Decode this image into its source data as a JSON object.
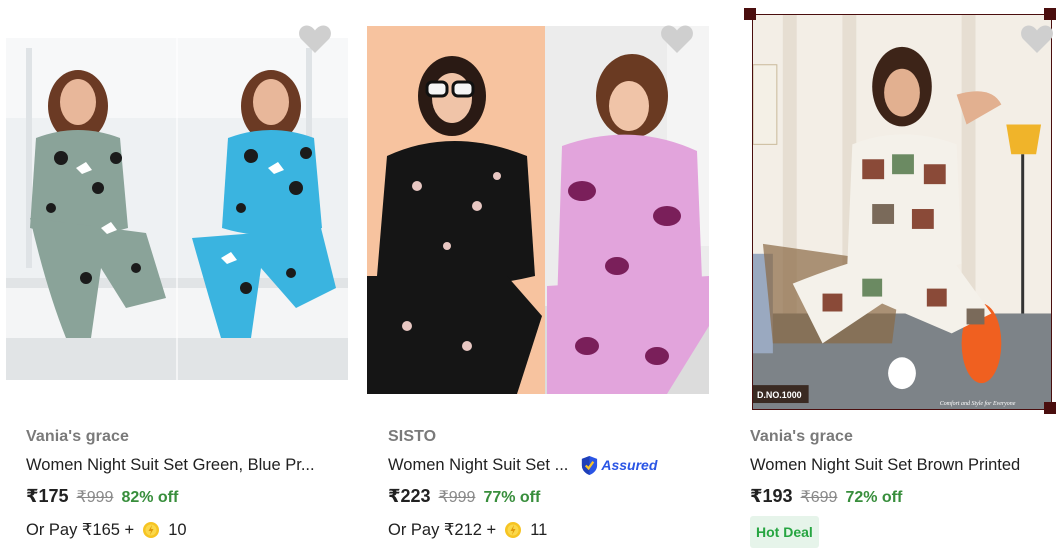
{
  "products": [
    {
      "brand": "Vania's grace",
      "title": "Women Night Suit Set Green, Blue Pr...",
      "price": "₹175",
      "mrp": "₹999",
      "discount": "82% off",
      "pay_text": "Or Pay ₹165 +",
      "coins": "10",
      "image_alt": "two women in green and blue printed night suits"
    },
    {
      "brand": "SISTO",
      "title": "Women Night Suit Set ...",
      "assured": "Assured",
      "price": "₹223",
      "mrp": "₹999",
      "discount": "77% off",
      "pay_text": "Or Pay ₹212 +",
      "coins": "11",
      "image_alt": "two women in black floral and pink floral night suits"
    },
    {
      "brand": "Vania's grace",
      "title": "Women Night Suit Set Brown Printed",
      "price": "₹193",
      "mrp": "₹699",
      "discount": "72% off",
      "badge": "Hot Deal",
      "image_alt": "woman in brown printed night suit seated on chair",
      "image_tag": "D.NO.1000",
      "image_caption": "Comfort and Style for Everyone"
    }
  ],
  "colors": {
    "discount": "#388e3c",
    "assured": "#2a55e5",
    "hot_deal_bg": "#e6f4ea",
    "hot_deal_text": "#26a541",
    "heart": "#cfcfcf"
  }
}
